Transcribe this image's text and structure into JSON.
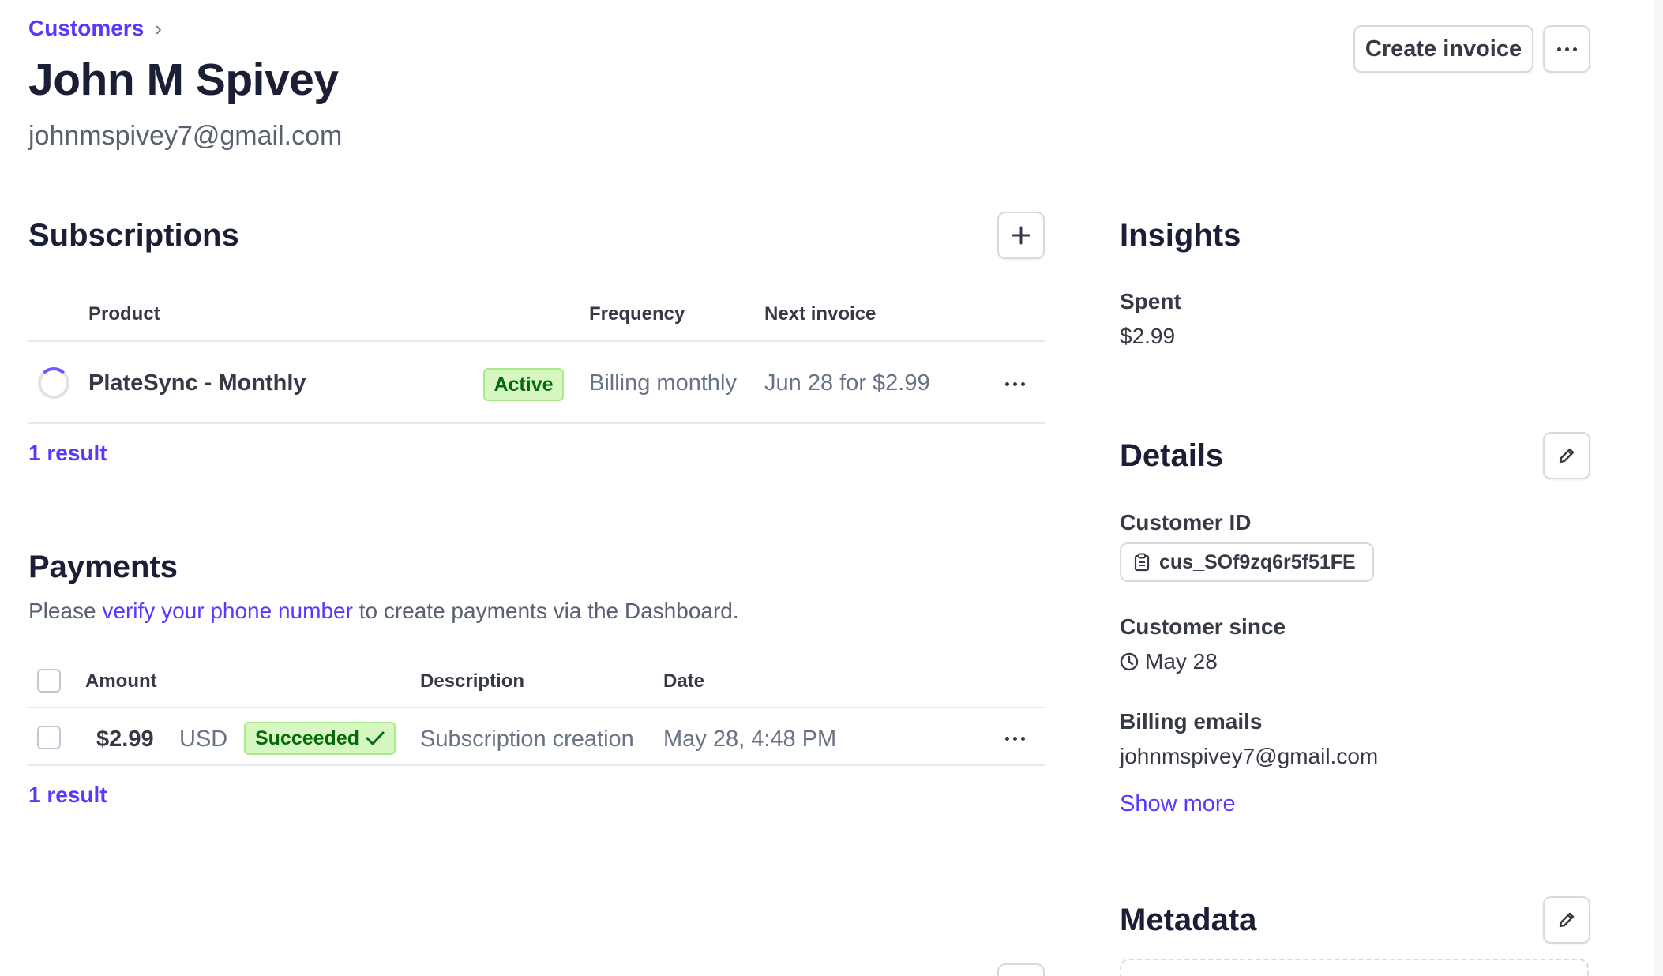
{
  "header": {
    "breadcrumb": "Customers",
    "title": "John M Spivey",
    "email": "johnmspivey7@gmail.com",
    "create_invoice_label": "Create invoice"
  },
  "subscriptions": {
    "title": "Subscriptions",
    "columns": {
      "product": "Product",
      "frequency": "Frequency",
      "next_invoice": "Next invoice"
    },
    "rows": [
      {
        "product": "PlateSync - Monthly",
        "status": "Active",
        "frequency": "Billing monthly",
        "next_invoice": "Jun 28 for $2.99"
      }
    ],
    "result_count": "1 result"
  },
  "payments": {
    "title": "Payments",
    "notice_prefix": "Please ",
    "notice_link": "verify your phone number",
    "notice_suffix": " to create payments via the Dashboard.",
    "columns": {
      "amount": "Amount",
      "description": "Description",
      "date": "Date"
    },
    "rows": [
      {
        "amount": "$2.99",
        "currency": "USD",
        "status": "Succeeded",
        "description": "Subscription creation",
        "date": "May 28, 4:48 PM"
      }
    ],
    "result_count": "1 result"
  },
  "insights": {
    "title": "Insights",
    "spent_label": "Spent",
    "spent_value": "$2.99"
  },
  "details": {
    "title": "Details",
    "customer_id_label": "Customer ID",
    "customer_id": "cus_SOf9zq6r5f51FE",
    "customer_since_label": "Customer since",
    "customer_since": "May 28",
    "billing_emails_label": "Billing emails",
    "billing_email": "johnmspivey7@gmail.com",
    "show_more": "Show more"
  },
  "metadata": {
    "title": "Metadata"
  },
  "colors": {
    "accent": "#533afd",
    "success_bg": "#d7f7c2",
    "success_text": "#05690d"
  }
}
